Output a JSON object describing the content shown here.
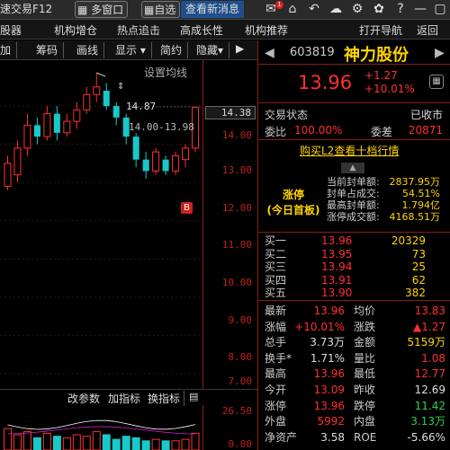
{
  "topbar": {
    "fast_trade": "速交易F12",
    "multi_window": "多窗口",
    "free": "自选",
    "news": "查看新消息",
    "badge": "1"
  },
  "menubar": [
    "股器",
    "机构增仓",
    "热点追击",
    "高成长性",
    "机构推荐",
    "打开导航",
    "返回"
  ],
  "chartbar": [
    "加",
    "筹码",
    "画线",
    "显示",
    "简约",
    "隐藏"
  ],
  "chart": {
    "ma_setting": "设置均线",
    "high_label": "14.87",
    "range_label": "14.00-13.98",
    "b_marker": "B",
    "axis_labels": [
      "14.00",
      "13.00",
      "12.00",
      "11.00",
      "10.00",
      "9.00",
      "8.00",
      "7.00"
    ],
    "current_tag": "14.38",
    "vol_axis_labels": [
      "26.50",
      "0.00"
    ]
  },
  "chart_data": {
    "type": "candlestick",
    "ylim": [
      6.6,
      15.2
    ],
    "candles": [
      {
        "o": 11.9,
        "c": 12.5,
        "h": 12.7,
        "l": 11.8,
        "up": true
      },
      {
        "o": 12.2,
        "c": 12.9,
        "h": 13.1,
        "l": 12.0,
        "up": true
      },
      {
        "o": 12.9,
        "c": 13.5,
        "h": 13.8,
        "l": 12.7,
        "up": true
      },
      {
        "o": 13.5,
        "c": 13.2,
        "h": 13.7,
        "l": 13.0,
        "up": false
      },
      {
        "o": 13.2,
        "c": 13.8,
        "h": 14.0,
        "l": 13.1,
        "up": true
      },
      {
        "o": 13.8,
        "c": 13.3,
        "h": 14.0,
        "l": 13.1,
        "up": false
      },
      {
        "o": 13.3,
        "c": 13.6,
        "h": 13.8,
        "l": 13.2,
        "up": true
      },
      {
        "o": 13.6,
        "c": 13.9,
        "h": 14.1,
        "l": 13.4,
        "up": true
      },
      {
        "o": 13.9,
        "c": 14.3,
        "h": 14.5,
        "l": 13.8,
        "up": true
      },
      {
        "o": 14.3,
        "c": 14.5,
        "h": 14.87,
        "l": 14.1,
        "up": true
      },
      {
        "o": 14.4,
        "c": 14.0,
        "h": 14.6,
        "l": 13.9,
        "up": false
      },
      {
        "o": 14.0,
        "c": 13.7,
        "h": 14.1,
        "l": 13.5,
        "up": false
      },
      {
        "o": 13.7,
        "c": 13.2,
        "h": 13.8,
        "l": 13.0,
        "up": false
      },
      {
        "o": 13.2,
        "c": 12.6,
        "h": 13.3,
        "l": 12.4,
        "up": false
      },
      {
        "o": 12.6,
        "c": 12.3,
        "h": 12.8,
        "l": 12.1,
        "up": false
      },
      {
        "o": 12.3,
        "c": 12.8,
        "h": 12.9,
        "l": 12.2,
        "up": true
      },
      {
        "o": 12.6,
        "c": 12.3,
        "h": 12.7,
        "l": 12.2,
        "up": false
      },
      {
        "o": 12.3,
        "c": 12.7,
        "h": 12.8,
        "l": 12.2,
        "up": true
      },
      {
        "o": 12.6,
        "c": 12.9,
        "h": 13.0,
        "l": 12.4,
        "up": true
      },
      {
        "o": 12.9,
        "c": 13.96,
        "h": 13.96,
        "l": 12.8,
        "up": true
      }
    ]
  },
  "subtoolbar": [
    "改参数",
    "加指标",
    "换指标"
  ],
  "quote": {
    "code": "603819",
    "name": "神力股份",
    "price": "13.96",
    "change": "+1.27",
    "change_pct": "+10.01%",
    "status_label": "交易状态",
    "status_value": "已收市",
    "wei_bi_label": "委比",
    "wei_bi_value": "100.00%",
    "wei_cha_label": "委差",
    "wei_cha_value": "20871",
    "buy_l2": "购买L2查看十档行情"
  },
  "limit": {
    "title": "涨停\n(今日首板)",
    "rows": [
      {
        "k": "当前封单额:",
        "v": "2837.95万"
      },
      {
        "k": "封单占成交:",
        "v": "54.51%"
      },
      {
        "k": "最高封单额:",
        "v": "1.794亿"
      },
      {
        "k": "涨停成交额:",
        "v": "4168.51万"
      }
    ]
  },
  "orderbook": [
    {
      "k": "买一",
      "p": "13.96",
      "q": "20329"
    },
    {
      "k": "买二",
      "p": "13.95",
      "q": "73"
    },
    {
      "k": "买三",
      "p": "13.94",
      "q": "25"
    },
    {
      "k": "买四",
      "p": "13.91",
      "q": "62"
    },
    {
      "k": "买五",
      "p": "13.90",
      "q": "382"
    }
  ],
  "stats": [
    {
      "k1": "最新",
      "v1": "13.96",
      "c1": "red",
      "k2": "均价",
      "v2": "13.83",
      "c2": "red"
    },
    {
      "k1": "涨幅",
      "v1": "+10.01%",
      "c1": "red",
      "k2": "涨跌",
      "v2": "▲1.27",
      "c2": "red"
    },
    {
      "k1": "总手",
      "v1": "3.73万",
      "c1": "wht",
      "k2": "金额",
      "v2": "5159万",
      "c2": "yel"
    },
    {
      "k1": "换手*",
      "v1": "1.71%",
      "c1": "wht",
      "k2": "量比",
      "v2": "1.08",
      "c2": "red"
    },
    {
      "k1": "最高",
      "v1": "13.96",
      "c1": "red",
      "k2": "最低",
      "v2": "12.77",
      "c2": "red"
    },
    {
      "k1": "今开",
      "v1": "13.09",
      "c1": "red",
      "k2": "昨收",
      "v2": "12.69",
      "c2": "wht"
    },
    {
      "k1": "涨停",
      "v1": "13.96",
      "c1": "red",
      "k2": "跌停",
      "v2": "11.42",
      "c2": "grn"
    },
    {
      "k1": "外盘",
      "v1": "5992",
      "c1": "red",
      "k2": "内盘",
      "v2": "3.13万",
      "c2": "grn"
    },
    {
      "k1": "净资产",
      "v1": "3.58",
      "c1": "wht",
      "k2": "ROE",
      "v2": "-5.66%",
      "c2": "wht"
    }
  ],
  "colors": {
    "up": "#ff3030",
    "down": "#19c8c8",
    "accent": "#ffd400",
    "border": "#8a1a1a"
  }
}
